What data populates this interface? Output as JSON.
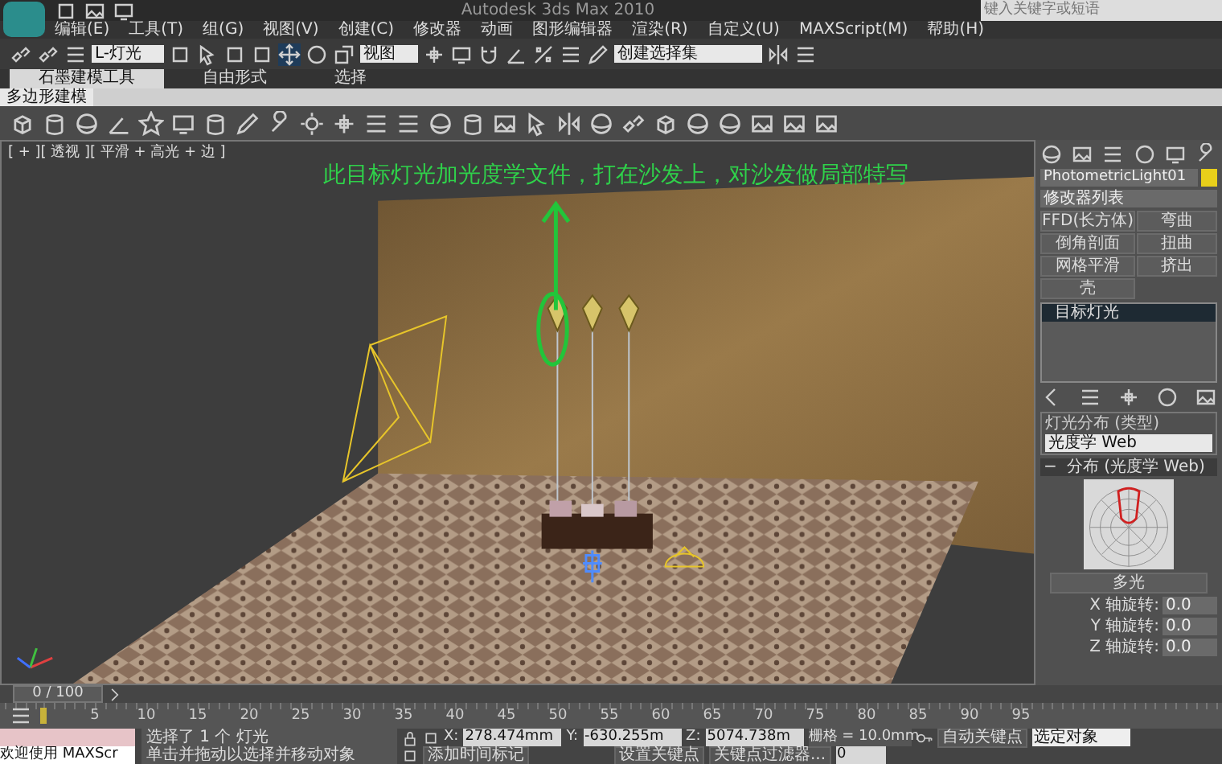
{
  "title_bar": {
    "title": "Autodesk 3ds Max 2010",
    "search": {
      "placeholder": "键入关键字或短语"
    }
  },
  "menu": [
    "编辑(E)",
    "工具(T)",
    "组(G)",
    "视图(V)",
    "创建(C)",
    "修改器",
    "动画",
    "图形编辑器",
    "渲染(R)",
    "自定义(U)",
    "MAXScript(M)",
    "帮助(H)"
  ],
  "toolbar": {
    "selection_filter": "L-灯光",
    "reference_coord": "视图",
    "named_selection": "创建选择集"
  },
  "ribbon": {
    "tabs": [
      {
        "label": "石墨建模工具",
        "selected": true
      },
      {
        "label": "自由形式",
        "selected": false
      },
      {
        "label": "选择",
        "selected": false
      }
    ],
    "panel": "多边形建模"
  },
  "viewport": {
    "label": "[ + ][ 透视 ][ 平滑 + 高光 + 边 ]",
    "annotation": "此目标灯光加光度学文件，打在沙发上，对沙发做局部特写"
  },
  "command_panel": {
    "object_name": "PhotometricLight01",
    "modifier_list": "修改器列表",
    "modifier_buttons": [
      "FFD(长方体)",
      "弯曲",
      "倒角剖面",
      "扭曲",
      "网格平滑",
      "挤出",
      "壳"
    ],
    "stack": [
      {
        "label": "目标灯光",
        "selected": true
      }
    ],
    "distribution_group": {
      "title": "灯光分布 (类型)",
      "value": "光度学 Web"
    },
    "web_rollout": {
      "title": "分布 (光度学 Web)",
      "toggle": "−",
      "file_button": "多光",
      "rotations": [
        {
          "label": "X 轴旋转:",
          "value": "0.0"
        },
        {
          "label": "Y 轴旋转:",
          "value": "0.0"
        },
        {
          "label": "Z 轴旋转:",
          "value": "0.0"
        }
      ]
    }
  },
  "timeline": {
    "frame": "0 / 100",
    "ruler_labels": [
      "5",
      "10",
      "15",
      "20",
      "25",
      "30",
      "35",
      "40",
      "45",
      "50",
      "55",
      "60",
      "65",
      "70",
      "75",
      "80",
      "85",
      "90",
      "95"
    ]
  },
  "status": {
    "maxscript": "欢迎使用 MAXScr",
    "selection_info": "选择了 1 个 灯光",
    "prompt": "单击并拖动以选择并移动对象",
    "coords": [
      {
        "axis": "X:",
        "value": "278.474mm"
      },
      {
        "axis": "Y:",
        "value": "-630.255m"
      },
      {
        "axis": "Z:",
        "value": "5074.738m"
      }
    ],
    "grid": "栅格 = 10.0mm",
    "add_time_tag": "添加时间标记",
    "auto_key": "自动关键点",
    "key_mode": "选定对象",
    "set_key": "设置关键点",
    "key_filters": "关键点过滤器...",
    "current_frame": "0"
  }
}
